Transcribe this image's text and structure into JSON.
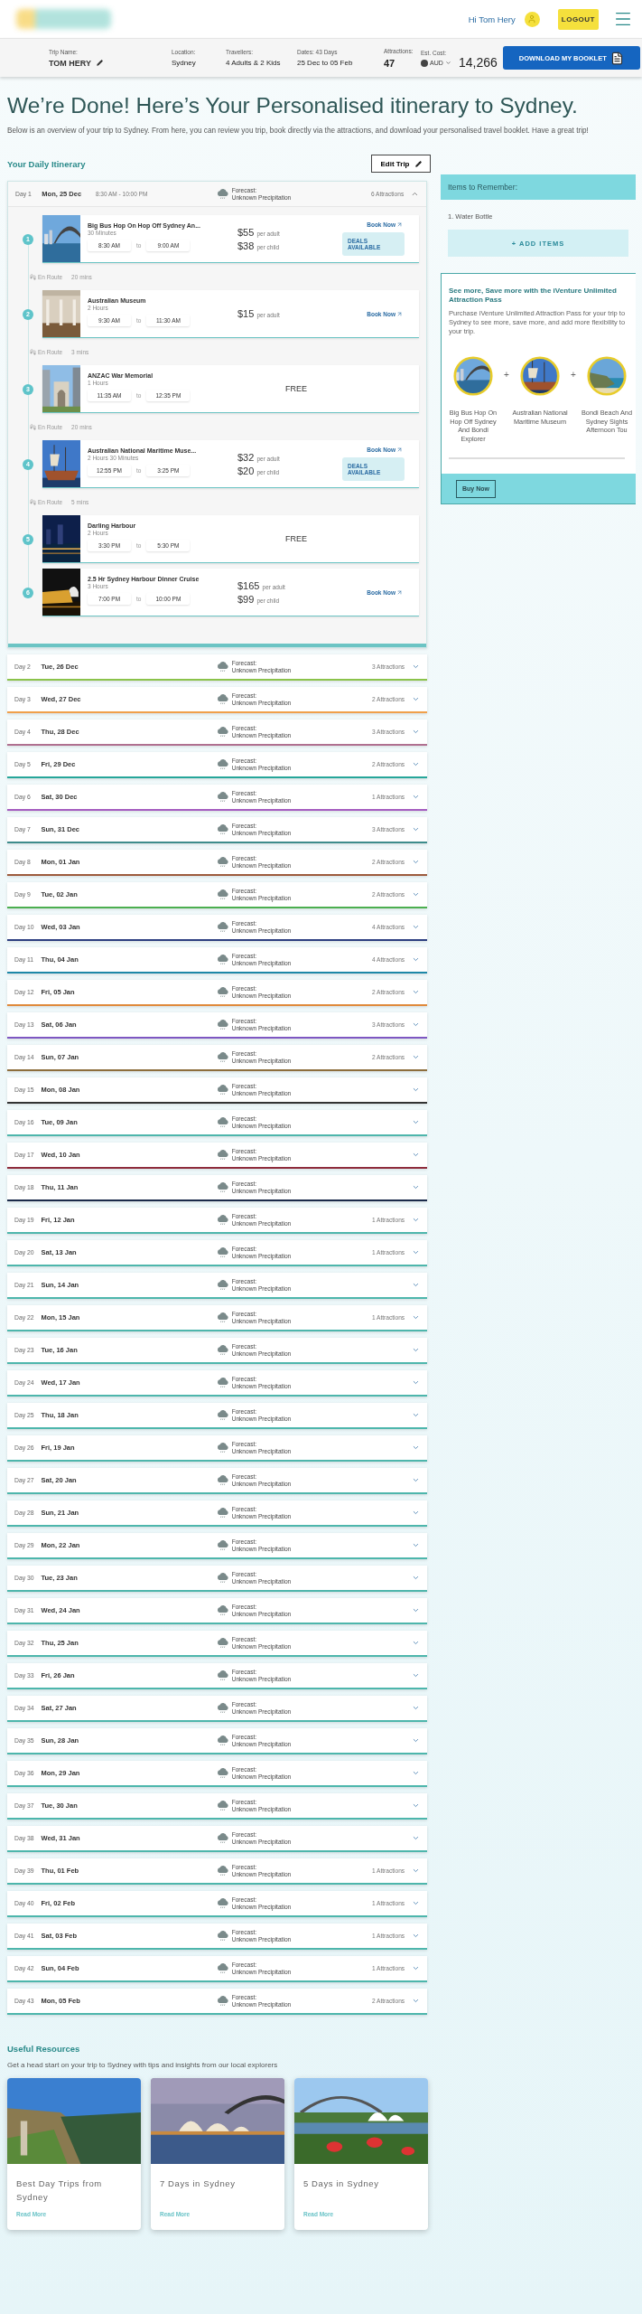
{
  "header": {
    "greeting": "Hi Tom Hery",
    "logout": "LOGOUT"
  },
  "trip_bar": {
    "trip_name_label": "Trip Name:",
    "trip_name": "TOM HERY",
    "location_label": "Location:",
    "location": "Sydney",
    "travellers_label": "Travellers:",
    "travellers": "4 Adults & 2 Kids",
    "dates_label": "Dates: 43 Days",
    "dates": "25 Dec to 05 Feb",
    "attractions_label": "Attractions:",
    "attractions": "47",
    "cost_label": "Est. Cost:",
    "currency": "AUD",
    "cost": "14,266",
    "download": "DOWNLOAD MY BOOKLET"
  },
  "title": "We’re Done! Here’s Your Personalised itinerary to Sydney.",
  "intro": "Below is an overview of your trip to Sydney. From here, you can review you trip, book directly via the attractions, and download your personalised travel booklet. Have a great trip!",
  "itinerary": {
    "heading": "Your Daily Itinerary",
    "edit": "Edit Trip",
    "days": [
      {
        "day": "Day 1",
        "date": "Mon, 25 Dec",
        "hours": "8:30 AM - 10:00 PM",
        "forecast_label": "Forecast:",
        "forecast": "Unknown Precipitation",
        "attractions": "6 Attractions",
        "expanded": true,
        "color": "#6cc4c4",
        "stops": [
          {
            "number": "1",
            "name": "Big Bus Hop On Hop Off Sydney An...",
            "duration": "30 Minutes",
            "start": "8:30 AM",
            "to": "to",
            "end": "9:00 AM",
            "prices": [
              {
                "amount": "$55",
                "unit": "per adult"
              },
              {
                "amount": "$38",
                "unit": "per child"
              }
            ],
            "book": "Book Now",
            "deals": "DEALS AVAILABLE",
            "transit": {
              "label": "En Route",
              "time": "20 mins"
            }
          },
          {
            "number": "2",
            "name": "Australian Museum",
            "duration": "2 Hours",
            "start": "9:30 AM",
            "to": "to",
            "end": "11:30 AM",
            "prices": [
              {
                "amount": "$15",
                "unit": "per adult"
              }
            ],
            "book": "Book Now",
            "transit": {
              "label": "En Route",
              "time": "3 mins"
            }
          },
          {
            "number": "3",
            "name": "ANZAC War Memorial",
            "duration": "1 Hours",
            "start": "11:35 AM",
            "to": "to",
            "end": "12:35 PM",
            "free": "FREE",
            "transit": {
              "label": "En Route",
              "time": "20 mins"
            }
          },
          {
            "number": "4",
            "name": "Australian National Maritime Muse...",
            "duration": "2 Hours 30 Minutes",
            "start": "12:55 PM",
            "to": "to",
            "end": "3:25 PM",
            "prices": [
              {
                "amount": "$32",
                "unit": "per adult"
              },
              {
                "amount": "$20",
                "unit": "per child"
              }
            ],
            "book": "Book Now",
            "deals": "DEALS AVAILABLE",
            "transit": {
              "label": "En Route",
              "time": "5 mins"
            }
          },
          {
            "number": "5",
            "name": "Darling Harbour",
            "duration": "2 Hours",
            "start": "3:30 PM",
            "to": "to",
            "end": "5:30 PM",
            "free": "FREE"
          },
          {
            "number": "6",
            "name": "2.5 Hr Sydney Harbour Dinner Cruise",
            "duration": "3 Hours",
            "start": "7:00 PM",
            "to": "to",
            "end": "10:00 PM",
            "prices": [
              {
                "amount": "$165",
                "unit": "per adult"
              },
              {
                "amount": "$99",
                "unit": "per child"
              }
            ],
            "book": "Book Now"
          }
        ]
      },
      {
        "day": "Day 2",
        "date": "Tue, 26 Dec",
        "forecast_label": "Forecast:",
        "forecast": "Unknown Precipitation",
        "attractions": "3 Attractions",
        "expanded": false,
        "color": "#8bc34a"
      },
      {
        "day": "Day 3",
        "date": "Wed, 27 Dec",
        "forecast_label": "Forecast:",
        "forecast": "Unknown Precipitation",
        "attractions": "2 Attractions",
        "expanded": false,
        "color": "#f0a04b"
      },
      {
        "day": "Day 4",
        "date": "Thu, 28 Dec",
        "forecast_label": "Forecast:",
        "forecast": "Unknown Precipitation",
        "attractions": "3 Attractions",
        "expanded": false,
        "color": "#b07090"
      },
      {
        "day": "Day 5",
        "date": "Fri, 29 Dec",
        "forecast_label": "Forecast:",
        "forecast": "Unknown Precipitation",
        "attractions": "2 Attractions",
        "expanded": false,
        "color": "#26a69a"
      },
      {
        "day": "Day 6",
        "date": "Sat, 30 Dec",
        "forecast_label": "Forecast:",
        "forecast": "Unknown Precipitation",
        "attractions": "1 Attractions",
        "expanded": false,
        "color": "#a45cc0"
      },
      {
        "day": "Day 7",
        "date": "Sun, 31 Dec",
        "forecast_label": "Forecast:",
        "forecast": "Unknown Precipitation",
        "attractions": "3 Attractions",
        "expanded": false,
        "color": "#3d8c8c"
      },
      {
        "day": "Day 8",
        "date": "Mon, 01 Jan",
        "forecast_label": "Forecast:",
        "forecast": "Unknown Precipitation",
        "attractions": "2 Attractions",
        "expanded": false,
        "color": "#9c5a3c"
      },
      {
        "day": "Day 9",
        "date": "Tue, 02 Jan",
        "forecast_label": "Forecast:",
        "forecast": "Unknown Precipitation",
        "attractions": "2 Attractions",
        "expanded": false,
        "color": "#4caf50"
      },
      {
        "day": "Day 10",
        "date": "Wed, 03 Jan",
        "forecast_label": "Forecast:",
        "forecast": "Unknown Precipitation",
        "attractions": "4 Attractions",
        "expanded": false,
        "color": "#2c3e80"
      },
      {
        "day": "Day 11",
        "date": "Thu, 04 Jan",
        "forecast_label": "Forecast:",
        "forecast": "Unknown Precipitation",
        "attractions": "4 Attractions",
        "expanded": false,
        "color": "#1e88a8"
      },
      {
        "day": "Day 12",
        "date": "Fri, 05 Jan",
        "forecast_label": "Forecast:",
        "forecast": "Unknown Precipitation",
        "attractions": "2 Attractions",
        "expanded": false,
        "color": "#e08a3c"
      },
      {
        "day": "Day 13",
        "date": "Sat, 06 Jan",
        "forecast_label": "Forecast:",
        "forecast": "Unknown Precipitation",
        "attractions": "3 Attractions",
        "expanded": false,
        "color": "#7e57c2"
      },
      {
        "day": "Day 14",
        "date": "Sun, 07 Jan",
        "forecast_label": "Forecast:",
        "forecast": "Unknown Precipitation",
        "attractions": "2 Attractions",
        "expanded": false,
        "color": "#8d6e3c"
      },
      {
        "day": "Day 15",
        "date": "Mon, 08 Jan",
        "forecast_label": "Forecast:",
        "forecast": "Unknown Precipitation",
        "expanded": false,
        "color": "#333333"
      },
      {
        "day": "Day 16",
        "date": "Tue, 09 Jan",
        "forecast_label": "Forecast:",
        "forecast": "Unknown Precipitation",
        "expanded": false,
        "color": "#4db6ac"
      },
      {
        "day": "Day 17",
        "date": "Wed, 10 Jan",
        "forecast_label": "Forecast:",
        "forecast": "Unknown Precipitation",
        "expanded": false,
        "color": "#8e2c3c"
      },
      {
        "day": "Day 18",
        "date": "Thu, 11 Jan",
        "forecast_label": "Forecast:",
        "forecast": "Unknown Precipitation",
        "expanded": false,
        "color": "#1a2a4a"
      },
      {
        "day": "Day 19",
        "date": "Fri, 12 Jan",
        "forecast_label": "Forecast:",
        "forecast": "Unknown Precipitation",
        "attractions": "1 Attractions",
        "expanded": false,
        "color": "#4db6ac"
      },
      {
        "day": "Day 20",
        "date": "Sat, 13 Jan",
        "forecast_label": "Forecast:",
        "forecast": "Unknown Precipitation",
        "attractions": "1 Attractions",
        "expanded": false,
        "color": "#4db6ac"
      },
      {
        "day": "Day 21",
        "date": "Sun, 14 Jan",
        "forecast_label": "Forecast:",
        "forecast": "Unknown Precipitation",
        "expanded": false,
        "color": "#4db6ac"
      },
      {
        "day": "Day 22",
        "date": "Mon, 15 Jan",
        "forecast_label": "Forecast:",
        "forecast": "Unknown Precipitation",
        "attractions": "1 Attractions",
        "expanded": false,
        "color": "#4db6ac"
      },
      {
        "day": "Day 23",
        "date": "Tue, 16 Jan",
        "forecast_label": "Forecast:",
        "forecast": "Unknown Precipitation",
        "expanded": false,
        "color": "#4db6ac"
      },
      {
        "day": "Day 24",
        "date": "Wed, 17 Jan",
        "forecast_label": "Forecast:",
        "forecast": "Unknown Precipitation",
        "expanded": false,
        "color": "#4db6ac"
      },
      {
        "day": "Day 25",
        "date": "Thu, 18 Jan",
        "forecast_label": "Forecast:",
        "forecast": "Unknown Precipitation",
        "expanded": false,
        "color": "#4db6ac"
      },
      {
        "day": "Day 26",
        "date": "Fri, 19 Jan",
        "forecast_label": "Forecast:",
        "forecast": "Unknown Precipitation",
        "expanded": false,
        "color": "#4db6ac"
      },
      {
        "day": "Day 27",
        "date": "Sat, 20 Jan",
        "forecast_label": "Forecast:",
        "forecast": "Unknown Precipitation",
        "expanded": false,
        "color": "#4db6ac"
      },
      {
        "day": "Day 28",
        "date": "Sun, 21 Jan",
        "forecast_label": "Forecast:",
        "forecast": "Unknown Precipitation",
        "expanded": false,
        "color": "#4db6ac"
      },
      {
        "day": "Day 29",
        "date": "Mon, 22 Jan",
        "forecast_label": "Forecast:",
        "forecast": "Unknown Precipitation",
        "expanded": false,
        "color": "#4db6ac"
      },
      {
        "day": "Day 30",
        "date": "Tue, 23 Jan",
        "forecast_label": "Forecast:",
        "forecast": "Unknown Precipitation",
        "expanded": false,
        "color": "#4db6ac"
      },
      {
        "day": "Day 31",
        "date": "Wed, 24 Jan",
        "forecast_label": "Forecast:",
        "forecast": "Unknown Precipitation",
        "expanded": false,
        "color": "#4db6ac"
      },
      {
        "day": "Day 32",
        "date": "Thu, 25 Jan",
        "forecast_label": "Forecast:",
        "forecast": "Unknown Precipitation",
        "expanded": false,
        "color": "#4db6ac"
      },
      {
        "day": "Day 33",
        "date": "Fri, 26 Jan",
        "forecast_label": "Forecast:",
        "forecast": "Unknown Precipitation",
        "expanded": false,
        "color": "#4db6ac"
      },
      {
        "day": "Day 34",
        "date": "Sat, 27 Jan",
        "forecast_label": "Forecast:",
        "forecast": "Unknown Precipitation",
        "expanded": false,
        "color": "#4db6ac"
      },
      {
        "day": "Day 35",
        "date": "Sun, 28 Jan",
        "forecast_label": "Forecast:",
        "forecast": "Unknown Precipitation",
        "expanded": false,
        "color": "#4db6ac"
      },
      {
        "day": "Day 36",
        "date": "Mon, 29 Jan",
        "forecast_label": "Forecast:",
        "forecast": "Unknown Precipitation",
        "expanded": false,
        "color": "#4db6ac"
      },
      {
        "day": "Day 37",
        "date": "Tue, 30 Jan",
        "forecast_label": "Forecast:",
        "forecast": "Unknown Precipitation",
        "expanded": false,
        "color": "#4db6ac"
      },
      {
        "day": "Day 38",
        "date": "Wed, 31 Jan",
        "forecast_label": "Forecast:",
        "forecast": "Unknown Precipitation",
        "expanded": false,
        "color": "#4db6ac"
      },
      {
        "day": "Day 39",
        "date": "Thu, 01 Feb",
        "forecast_label": "Forecast:",
        "forecast": "Unknown Precipitation",
        "attractions": "1 Attractions",
        "expanded": false,
        "color": "#4db6ac"
      },
      {
        "day": "Day 40",
        "date": "Fri, 02 Feb",
        "forecast_label": "Forecast:",
        "forecast": "Unknown Precipitation",
        "attractions": "1 Attractions",
        "expanded": false,
        "color": "#4db6ac"
      },
      {
        "day": "Day 41",
        "date": "Sat, 03 Feb",
        "forecast_label": "Forecast:",
        "forecast": "Unknown Precipitation",
        "attractions": "1 Attractions",
        "expanded": false,
        "color": "#4db6ac"
      },
      {
        "day": "Day 42",
        "date": "Sun, 04 Feb",
        "forecast_label": "Forecast:",
        "forecast": "Unknown Precipitation",
        "attractions": "1 Attractions",
        "expanded": false,
        "color": "#4db6ac"
      },
      {
        "day": "Day 43",
        "date": "Mon, 05 Feb",
        "forecast_label": "Forecast:",
        "forecast": "Unknown Precipitation",
        "attractions": "2 Attractions",
        "expanded": false,
        "color": "#4db6ac"
      }
    ]
  },
  "remember": {
    "heading": "Items to Remember:",
    "items": [
      "1. Water Bottle"
    ],
    "add": "+ ADD ITEMS"
  },
  "pass": {
    "title": "See more, Save more with the iVenture Unlimited Attraction Pass",
    "text": "Purchase iVenture Unlimited Attraction Pass for your trip to Sydney to see more, save more, and add more flexibility to your trip.",
    "attractions": [
      {
        "name": "Big Bus Hop On Hop Off Sydney And Bondi Explorer",
        "plus": "+"
      },
      {
        "name": "Australian National Maritime Museum",
        "plus": "+"
      },
      {
        "name": "Bondi Beach And Sydney Sights Afternoon Tou"
      }
    ],
    "buy": "Buy Now"
  },
  "resources": {
    "heading": "Useful Resources",
    "text": "Get a head start on your trip to Sydney with tips and insights from our local explorers",
    "articles": [
      {
        "title": "Best Day Trips from Sydney",
        "link": "Read More"
      },
      {
        "title": "7 Days in Sydney",
        "link": "Read More"
      },
      {
        "title": "5 Days in Sydney",
        "link": "Read More"
      }
    ]
  }
}
